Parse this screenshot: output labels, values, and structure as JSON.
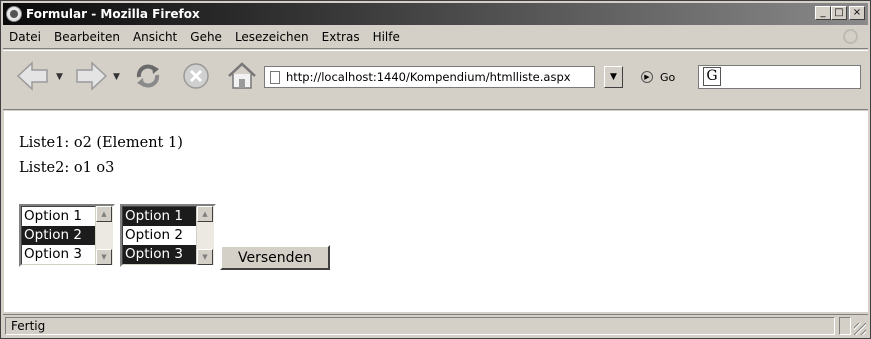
{
  "window": {
    "title": "Formular - Mozilla Firefox",
    "controls": [
      "_",
      "□",
      "×"
    ]
  },
  "menu": {
    "items": [
      "Datei",
      "Bearbeiten",
      "Ansicht",
      "Gehe",
      "Lesezeichen",
      "Extras",
      "Hilfe"
    ]
  },
  "toolbar": {
    "icons": [
      "back-icon",
      "forward-icon",
      "reload-icon",
      "stop-icon",
      "home-icon"
    ],
    "url": "http://localhost:1440/Kompendium/htmlliste.aspx",
    "go_label": "Go",
    "search_logo": "G"
  },
  "page": {
    "line1": "Liste1: o2 (Element 1)",
    "line2": "Liste2: o1 o3",
    "list1": {
      "options": [
        "Option 1",
        "Option 2",
        "Option 3"
      ],
      "selected": [
        false,
        true,
        false
      ]
    },
    "list2": {
      "options": [
        "Option 1",
        "Option 2",
        "Option 3"
      ],
      "selected": [
        true,
        false,
        true
      ]
    },
    "submit_label": "Versenden"
  },
  "status": {
    "text": "Fertig"
  },
  "colors": {
    "chrome": "#d4d0c8",
    "selection": "#1c1c1c",
    "content": "#ffffff"
  }
}
